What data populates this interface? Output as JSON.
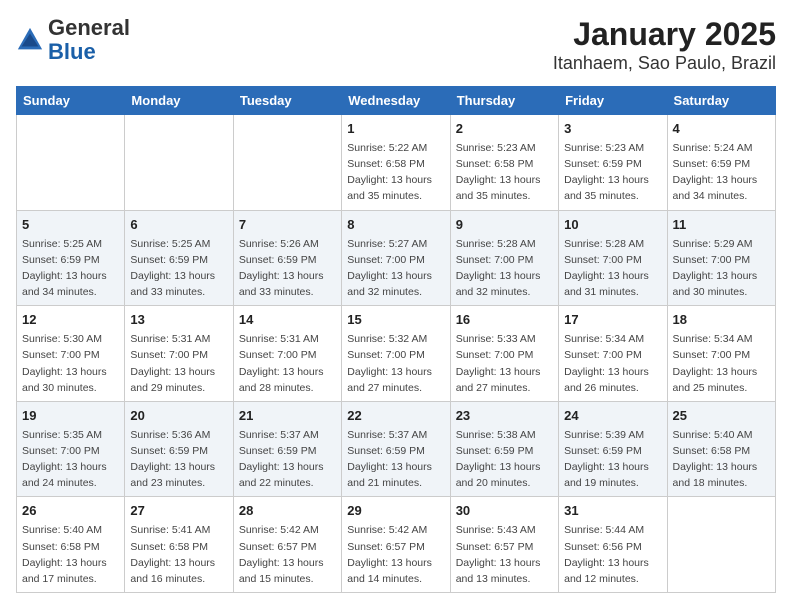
{
  "header": {
    "logo_line1": "General",
    "logo_line2": "Blue",
    "title": "January 2025",
    "subtitle": "Itanhaem, Sao Paulo, Brazil"
  },
  "weekdays": [
    "Sunday",
    "Monday",
    "Tuesday",
    "Wednesday",
    "Thursday",
    "Friday",
    "Saturday"
  ],
  "weeks": [
    [
      {
        "day": "",
        "info": ""
      },
      {
        "day": "",
        "info": ""
      },
      {
        "day": "",
        "info": ""
      },
      {
        "day": "1",
        "info": "Sunrise: 5:22 AM\nSunset: 6:58 PM\nDaylight: 13 hours\nand 35 minutes."
      },
      {
        "day": "2",
        "info": "Sunrise: 5:23 AM\nSunset: 6:58 PM\nDaylight: 13 hours\nand 35 minutes."
      },
      {
        "day": "3",
        "info": "Sunrise: 5:23 AM\nSunset: 6:59 PM\nDaylight: 13 hours\nand 35 minutes."
      },
      {
        "day": "4",
        "info": "Sunrise: 5:24 AM\nSunset: 6:59 PM\nDaylight: 13 hours\nand 34 minutes."
      }
    ],
    [
      {
        "day": "5",
        "info": "Sunrise: 5:25 AM\nSunset: 6:59 PM\nDaylight: 13 hours\nand 34 minutes."
      },
      {
        "day": "6",
        "info": "Sunrise: 5:25 AM\nSunset: 6:59 PM\nDaylight: 13 hours\nand 33 minutes."
      },
      {
        "day": "7",
        "info": "Sunrise: 5:26 AM\nSunset: 6:59 PM\nDaylight: 13 hours\nand 33 minutes."
      },
      {
        "day": "8",
        "info": "Sunrise: 5:27 AM\nSunset: 7:00 PM\nDaylight: 13 hours\nand 32 minutes."
      },
      {
        "day": "9",
        "info": "Sunrise: 5:28 AM\nSunset: 7:00 PM\nDaylight: 13 hours\nand 32 minutes."
      },
      {
        "day": "10",
        "info": "Sunrise: 5:28 AM\nSunset: 7:00 PM\nDaylight: 13 hours\nand 31 minutes."
      },
      {
        "day": "11",
        "info": "Sunrise: 5:29 AM\nSunset: 7:00 PM\nDaylight: 13 hours\nand 30 minutes."
      }
    ],
    [
      {
        "day": "12",
        "info": "Sunrise: 5:30 AM\nSunset: 7:00 PM\nDaylight: 13 hours\nand 30 minutes."
      },
      {
        "day": "13",
        "info": "Sunrise: 5:31 AM\nSunset: 7:00 PM\nDaylight: 13 hours\nand 29 minutes."
      },
      {
        "day": "14",
        "info": "Sunrise: 5:31 AM\nSunset: 7:00 PM\nDaylight: 13 hours\nand 28 minutes."
      },
      {
        "day": "15",
        "info": "Sunrise: 5:32 AM\nSunset: 7:00 PM\nDaylight: 13 hours\nand 27 minutes."
      },
      {
        "day": "16",
        "info": "Sunrise: 5:33 AM\nSunset: 7:00 PM\nDaylight: 13 hours\nand 27 minutes."
      },
      {
        "day": "17",
        "info": "Sunrise: 5:34 AM\nSunset: 7:00 PM\nDaylight: 13 hours\nand 26 minutes."
      },
      {
        "day": "18",
        "info": "Sunrise: 5:34 AM\nSunset: 7:00 PM\nDaylight: 13 hours\nand 25 minutes."
      }
    ],
    [
      {
        "day": "19",
        "info": "Sunrise: 5:35 AM\nSunset: 7:00 PM\nDaylight: 13 hours\nand 24 minutes."
      },
      {
        "day": "20",
        "info": "Sunrise: 5:36 AM\nSunset: 6:59 PM\nDaylight: 13 hours\nand 23 minutes."
      },
      {
        "day": "21",
        "info": "Sunrise: 5:37 AM\nSunset: 6:59 PM\nDaylight: 13 hours\nand 22 minutes."
      },
      {
        "day": "22",
        "info": "Sunrise: 5:37 AM\nSunset: 6:59 PM\nDaylight: 13 hours\nand 21 minutes."
      },
      {
        "day": "23",
        "info": "Sunrise: 5:38 AM\nSunset: 6:59 PM\nDaylight: 13 hours\nand 20 minutes."
      },
      {
        "day": "24",
        "info": "Sunrise: 5:39 AM\nSunset: 6:59 PM\nDaylight: 13 hours\nand 19 minutes."
      },
      {
        "day": "25",
        "info": "Sunrise: 5:40 AM\nSunset: 6:58 PM\nDaylight: 13 hours\nand 18 minutes."
      }
    ],
    [
      {
        "day": "26",
        "info": "Sunrise: 5:40 AM\nSunset: 6:58 PM\nDaylight: 13 hours\nand 17 minutes."
      },
      {
        "day": "27",
        "info": "Sunrise: 5:41 AM\nSunset: 6:58 PM\nDaylight: 13 hours\nand 16 minutes."
      },
      {
        "day": "28",
        "info": "Sunrise: 5:42 AM\nSunset: 6:57 PM\nDaylight: 13 hours\nand 15 minutes."
      },
      {
        "day": "29",
        "info": "Sunrise: 5:42 AM\nSunset: 6:57 PM\nDaylight: 13 hours\nand 14 minutes."
      },
      {
        "day": "30",
        "info": "Sunrise: 5:43 AM\nSunset: 6:57 PM\nDaylight: 13 hours\nand 13 minutes."
      },
      {
        "day": "31",
        "info": "Sunrise: 5:44 AM\nSunset: 6:56 PM\nDaylight: 13 hours\nand 12 minutes."
      },
      {
        "day": "",
        "info": ""
      }
    ]
  ]
}
